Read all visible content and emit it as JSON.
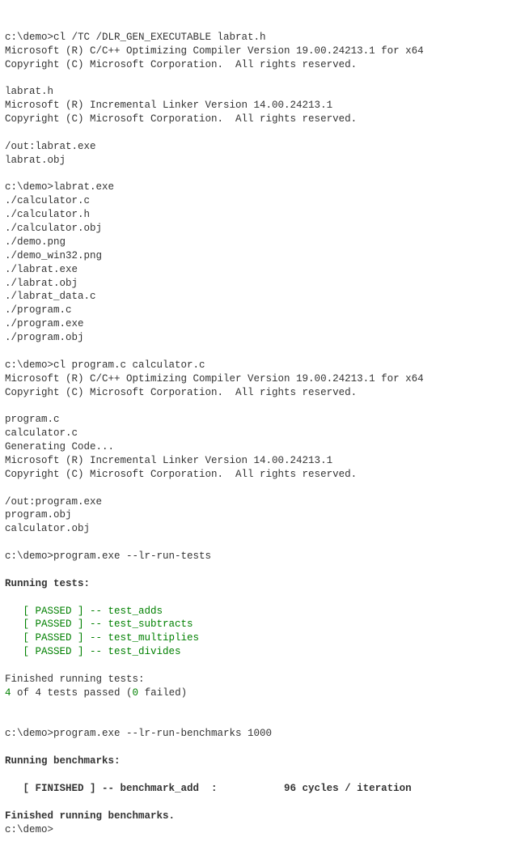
{
  "prompt1": "c:\\demo>cl /TC /DLR_GEN_EXECUTABLE labrat.h",
  "cl_banner_line1": "Microsoft (R) C/C++ Optimizing Compiler Version 19.00.24213.1 for x64",
  "cl_banner_line2": "Copyright (C) Microsoft Corporation.  All rights reserved.",
  "compiling_file1": "labrat.h",
  "link_banner1": "Microsoft (R) Incremental Linker Version 14.00.24213.1",
  "link_banner2": "Copyright (C) Microsoft Corporation.  All rights reserved.",
  "out_labrat_exe": "/out:labrat.exe",
  "labrat_obj": "labrat.obj",
  "prompt2": "c:\\demo>labrat.exe",
  "dirlist": [
    "./calculator.c",
    "./calculator.h",
    "./calculator.obj",
    "./demo.png",
    "./demo_win32.png",
    "./labrat.exe",
    "./labrat.obj",
    "./labrat_data.c",
    "./program.c",
    "./program.exe",
    "./program.obj"
  ],
  "prompt3": "c:\\demo>cl program.c calculator.c",
  "compiling_prog": "program.c",
  "compiling_calc": "calculator.c",
  "gen_code": "Generating Code...",
  "out_program_exe": "/out:program.exe",
  "program_obj": "program.obj",
  "calculator_obj": "calculator.obj",
  "prompt4": "c:\\demo>program.exe --lr-run-tests",
  "running_tests_heading": "Running tests:",
  "tests": [
    "   [ PASSED ] -- test_adds",
    "   [ PASSED ] -- test_subtracts",
    "   [ PASSED ] -- test_multiplies",
    "   [ PASSED ] -- test_divides"
  ],
  "finished_tests": "Finished running tests:",
  "summary_count_passed": "4",
  "summary_mid": " of 4 tests passed (",
  "summary_count_failed": "0",
  "summary_end": " failed)",
  "prompt5": "c:\\demo>program.exe --lr-run-benchmarks 1000",
  "running_benchmarks_heading": "Running benchmarks:",
  "benchmark_line": "   [ FINISHED ] -- benchmark_add  :           96 cycles / iteration",
  "finished_benchmarks": "Finished running benchmarks.",
  "prompt6": "c:\\demo>"
}
